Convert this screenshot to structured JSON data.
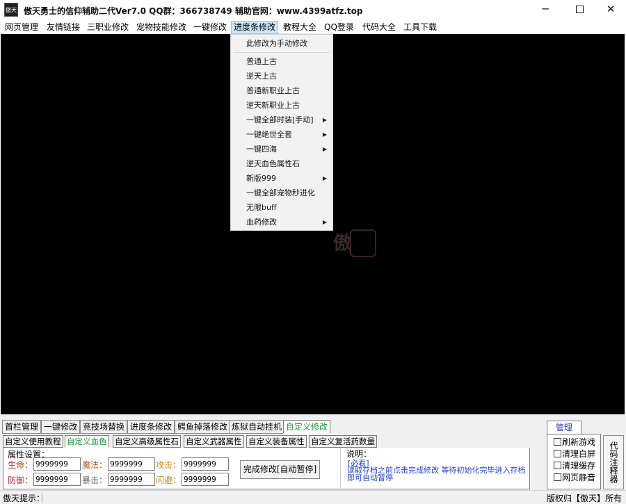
{
  "window": {
    "icon_label": "傲天",
    "title": "傲天勇士的信仰辅助二代Ver7.0  QQ群：366738749  辅助官网：www.4399atfz.top"
  },
  "menubar": {
    "items": [
      "网页管理",
      "友情链接",
      "三职业修改",
      "宠物技能修改",
      "一键修改",
      "进度条修改",
      "教程大全",
      "QQ登录",
      "代码大全",
      "工具下载"
    ]
  },
  "watermark": "傲",
  "dropdown": {
    "header": "此修改为手动修改",
    "items": [
      {
        "label": "普通上古",
        "submenu": false
      },
      {
        "label": "逆天上古",
        "submenu": false
      },
      {
        "label": "普通新职业上古",
        "submenu": false
      },
      {
        "label": "逆天新职业上古",
        "submenu": false
      },
      {
        "label": "一键全部时装[手动]",
        "submenu": true
      },
      {
        "label": "一键绝世全套",
        "submenu": true
      },
      {
        "label": "一键四海",
        "submenu": true
      },
      {
        "label": "逆天血色属性石",
        "submenu": false
      },
      {
        "label": "新版999",
        "submenu": true
      },
      {
        "label": "一键全部宠物秒进化",
        "submenu": false
      },
      {
        "label": "无限buff",
        "submenu": false
      },
      {
        "label": "血药修改",
        "submenu": true
      }
    ]
  },
  "tabs_top": [
    "首栏管理",
    "一键修改",
    "竞技场替换",
    "进度条修改",
    "鳄鱼掉落修改",
    "炼狱自动挂机",
    "自定义修改"
  ],
  "tabs_sub": [
    "自定义使用教程",
    "自定义血色",
    "自定义高级属性石",
    "自定义武器属性",
    "自定义装备属性",
    "自定义复活药数量"
  ],
  "attr": {
    "label": "属性设置：",
    "hp_label": "生命：",
    "hp": "9999999",
    "mp_label": "魔法：",
    "mp": "9999999",
    "atk_label": "攻击：",
    "atk": "9999999",
    "def_label": "防御：",
    "def": "9999999",
    "crit_label": "暴击：",
    "crit": "9999999",
    "dodge_label": "闪避：",
    "dodge": "9999999",
    "complete_button": "完成修改[自动暂停]"
  },
  "note": {
    "title": "说明：",
    "must": "[必看]",
    "text": "读取存档之前点击完成修改 等待初始化完毕进入存档即可自动暂停"
  },
  "manage": {
    "tab": "管理",
    "checks": [
      "刷新游戏",
      "清理白屏",
      "清理缓存",
      "网页静音"
    ],
    "code_button": "代码注释器"
  },
  "status": {
    "left": "傲天提示：",
    "right": "版权归【傲天】所有"
  },
  "colors": {
    "selected_tab_text": "#1a9a3a",
    "note_text": "#1f3fd6",
    "hp_label": "#d43a1a",
    "mp_label": "#b85a1a",
    "atk_label": "#e08a1a",
    "def_label": "#c02a2a",
    "crit_label": "#6a6a6a",
    "dodge_label": "#b88a2a"
  }
}
